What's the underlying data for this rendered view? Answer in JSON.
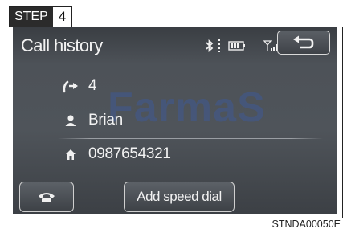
{
  "step": {
    "label": "STEP",
    "number": "4"
  },
  "header": {
    "title": "Call history"
  },
  "status_icons": [
    "bluetooth-icon",
    "battery-icon",
    "signal-icon"
  ],
  "details": [
    {
      "icon": "call-redirect-icon",
      "text": "4"
    },
    {
      "icon": "person-icon",
      "text": "Brian"
    },
    {
      "icon": "home-phone-icon",
      "text": "0987654321"
    }
  ],
  "watermark": "FarmaS",
  "buttons": {
    "add_speed_dial": "Add speed dial"
  },
  "caption": "STNDA00050E",
  "colors": {
    "screen_bg": "#4f545a",
    "text": "#f3f3f3",
    "watermark": "#3c5aa0"
  }
}
